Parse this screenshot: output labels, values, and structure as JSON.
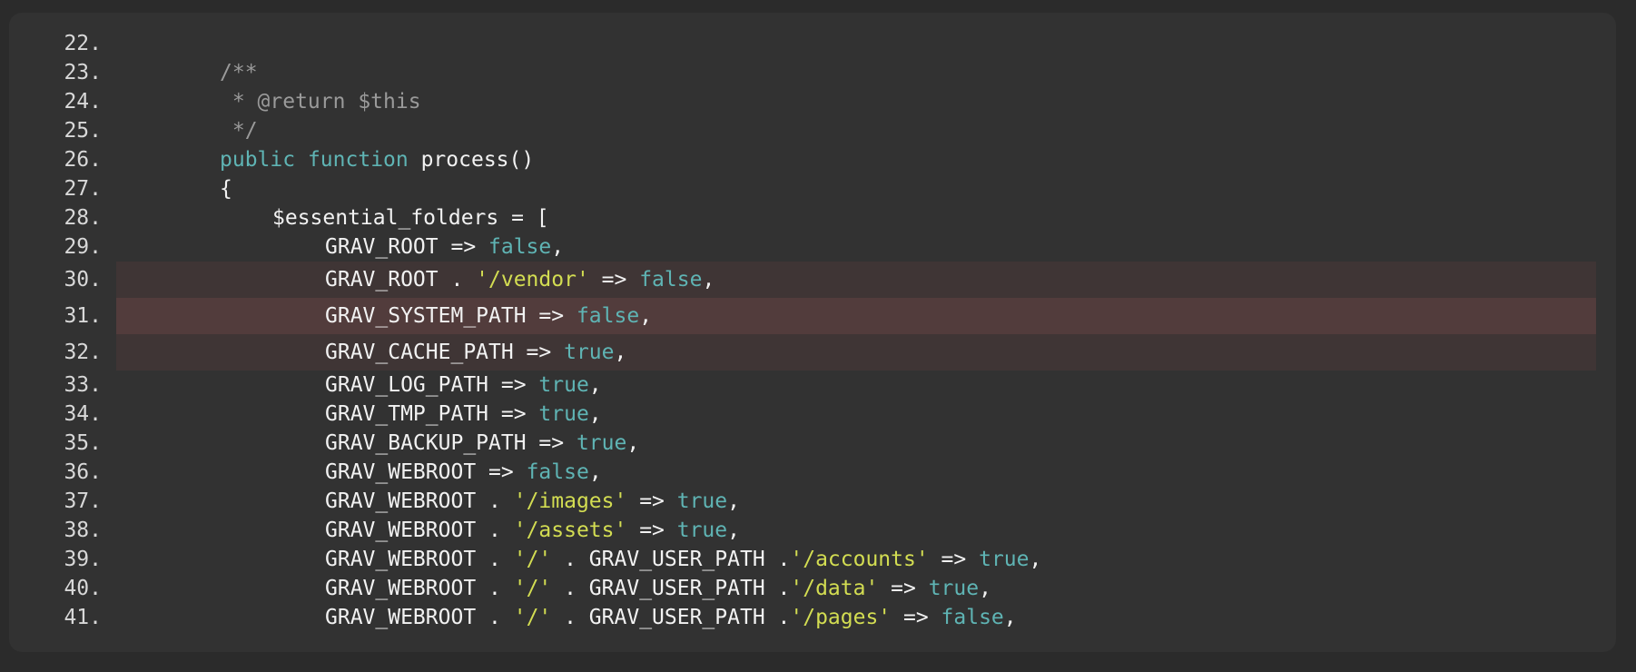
{
  "colors": {
    "background": "#2b2b2b",
    "panel": "#323232",
    "text": "#f2f2f2",
    "keyword": "#5fb4b4",
    "string": "#d3dd52",
    "comment": "#9a9a9a",
    "highlight_light": "#3f3535",
    "highlight_strong": "#523c3c"
  },
  "code": {
    "language": "php",
    "lines": [
      {
        "num": "22.",
        "indent": 0,
        "tokens": []
      },
      {
        "num": "23.",
        "indent": 4,
        "tokens": [
          {
            "t": "c",
            "v": "/**"
          }
        ]
      },
      {
        "num": "24.",
        "indent": 4,
        "tokens": [
          {
            "t": "c",
            "v": " * @return $this"
          }
        ]
      },
      {
        "num": "25.",
        "indent": 4,
        "tokens": [
          {
            "t": "c",
            "v": " */"
          }
        ]
      },
      {
        "num": "26.",
        "indent": 4,
        "tokens": [
          {
            "t": "k",
            "v": "public"
          },
          {
            "t": "p",
            "v": " "
          },
          {
            "t": "k",
            "v": "function"
          },
          {
            "t": "p",
            "v": " process()"
          }
        ]
      },
      {
        "num": "27.",
        "indent": 4,
        "tokens": [
          {
            "t": "p",
            "v": "{"
          }
        ]
      },
      {
        "num": "28.",
        "indent": 8,
        "tokens": [
          {
            "t": "p",
            "v": "$essential_folders = ["
          }
        ]
      },
      {
        "num": "29.",
        "indent": 12,
        "tokens": [
          {
            "t": "p",
            "v": "GRAV_ROOT => "
          },
          {
            "t": "k",
            "v": "false"
          },
          {
            "t": "p",
            "v": ","
          }
        ]
      },
      {
        "num": "30.",
        "indent": 12,
        "highlight": "light",
        "tokens": [
          {
            "t": "p",
            "v": "GRAV_ROOT . "
          },
          {
            "t": "s",
            "v": "'/vendor'"
          },
          {
            "t": "p",
            "v": " => "
          },
          {
            "t": "k",
            "v": "false"
          },
          {
            "t": "p",
            "v": ","
          }
        ]
      },
      {
        "num": "31.",
        "indent": 12,
        "highlight": "strong",
        "tokens": [
          {
            "t": "p",
            "v": "GRAV_SYSTEM_PATH => "
          },
          {
            "t": "k",
            "v": "false"
          },
          {
            "t": "p",
            "v": ","
          }
        ]
      },
      {
        "num": "32.",
        "indent": 12,
        "highlight": "light",
        "tokens": [
          {
            "t": "p",
            "v": "GRAV_CACHE_PATH => "
          },
          {
            "t": "k",
            "v": "true"
          },
          {
            "t": "p",
            "v": ","
          }
        ]
      },
      {
        "num": "33.",
        "indent": 12,
        "tokens": [
          {
            "t": "p",
            "v": "GRAV_LOG_PATH => "
          },
          {
            "t": "k",
            "v": "true"
          },
          {
            "t": "p",
            "v": ","
          }
        ]
      },
      {
        "num": "34.",
        "indent": 12,
        "tokens": [
          {
            "t": "p",
            "v": "GRAV_TMP_PATH => "
          },
          {
            "t": "k",
            "v": "true"
          },
          {
            "t": "p",
            "v": ","
          }
        ]
      },
      {
        "num": "35.",
        "indent": 12,
        "tokens": [
          {
            "t": "p",
            "v": "GRAV_BACKUP_PATH => "
          },
          {
            "t": "k",
            "v": "true"
          },
          {
            "t": "p",
            "v": ","
          }
        ]
      },
      {
        "num": "36.",
        "indent": 12,
        "tokens": [
          {
            "t": "p",
            "v": "GRAV_WEBROOT => "
          },
          {
            "t": "k",
            "v": "false"
          },
          {
            "t": "p",
            "v": ","
          }
        ]
      },
      {
        "num": "37.",
        "indent": 12,
        "tokens": [
          {
            "t": "p",
            "v": "GRAV_WEBROOT . "
          },
          {
            "t": "s",
            "v": "'/images'"
          },
          {
            "t": "p",
            "v": " => "
          },
          {
            "t": "k",
            "v": "true"
          },
          {
            "t": "p",
            "v": ","
          }
        ]
      },
      {
        "num": "38.",
        "indent": 12,
        "tokens": [
          {
            "t": "p",
            "v": "GRAV_WEBROOT . "
          },
          {
            "t": "s",
            "v": "'/assets'"
          },
          {
            "t": "p",
            "v": " => "
          },
          {
            "t": "k",
            "v": "true"
          },
          {
            "t": "p",
            "v": ","
          }
        ]
      },
      {
        "num": "39.",
        "indent": 12,
        "tokens": [
          {
            "t": "p",
            "v": "GRAV_WEBROOT . "
          },
          {
            "t": "s",
            "v": "'/'"
          },
          {
            "t": "p",
            "v": " . GRAV_USER_PATH ."
          },
          {
            "t": "s",
            "v": "'/accounts'"
          },
          {
            "t": "p",
            "v": " => "
          },
          {
            "t": "k",
            "v": "true"
          },
          {
            "t": "p",
            "v": ","
          }
        ]
      },
      {
        "num": "40.",
        "indent": 12,
        "tokens": [
          {
            "t": "p",
            "v": "GRAV_WEBROOT . "
          },
          {
            "t": "s",
            "v": "'/'"
          },
          {
            "t": "p",
            "v": " . GRAV_USER_PATH ."
          },
          {
            "t": "s",
            "v": "'/data'"
          },
          {
            "t": "p",
            "v": " => "
          },
          {
            "t": "k",
            "v": "true"
          },
          {
            "t": "p",
            "v": ","
          }
        ]
      },
      {
        "num": "41.",
        "indent": 12,
        "tokens": [
          {
            "t": "p",
            "v": "GRAV_WEBROOT . "
          },
          {
            "t": "s",
            "v": "'/'"
          },
          {
            "t": "p",
            "v": " . GRAV_USER_PATH ."
          },
          {
            "t": "s",
            "v": "'/pages'"
          },
          {
            "t": "p",
            "v": " => "
          },
          {
            "t": "k",
            "v": "false"
          },
          {
            "t": "p",
            "v": ","
          }
        ]
      }
    ]
  }
}
